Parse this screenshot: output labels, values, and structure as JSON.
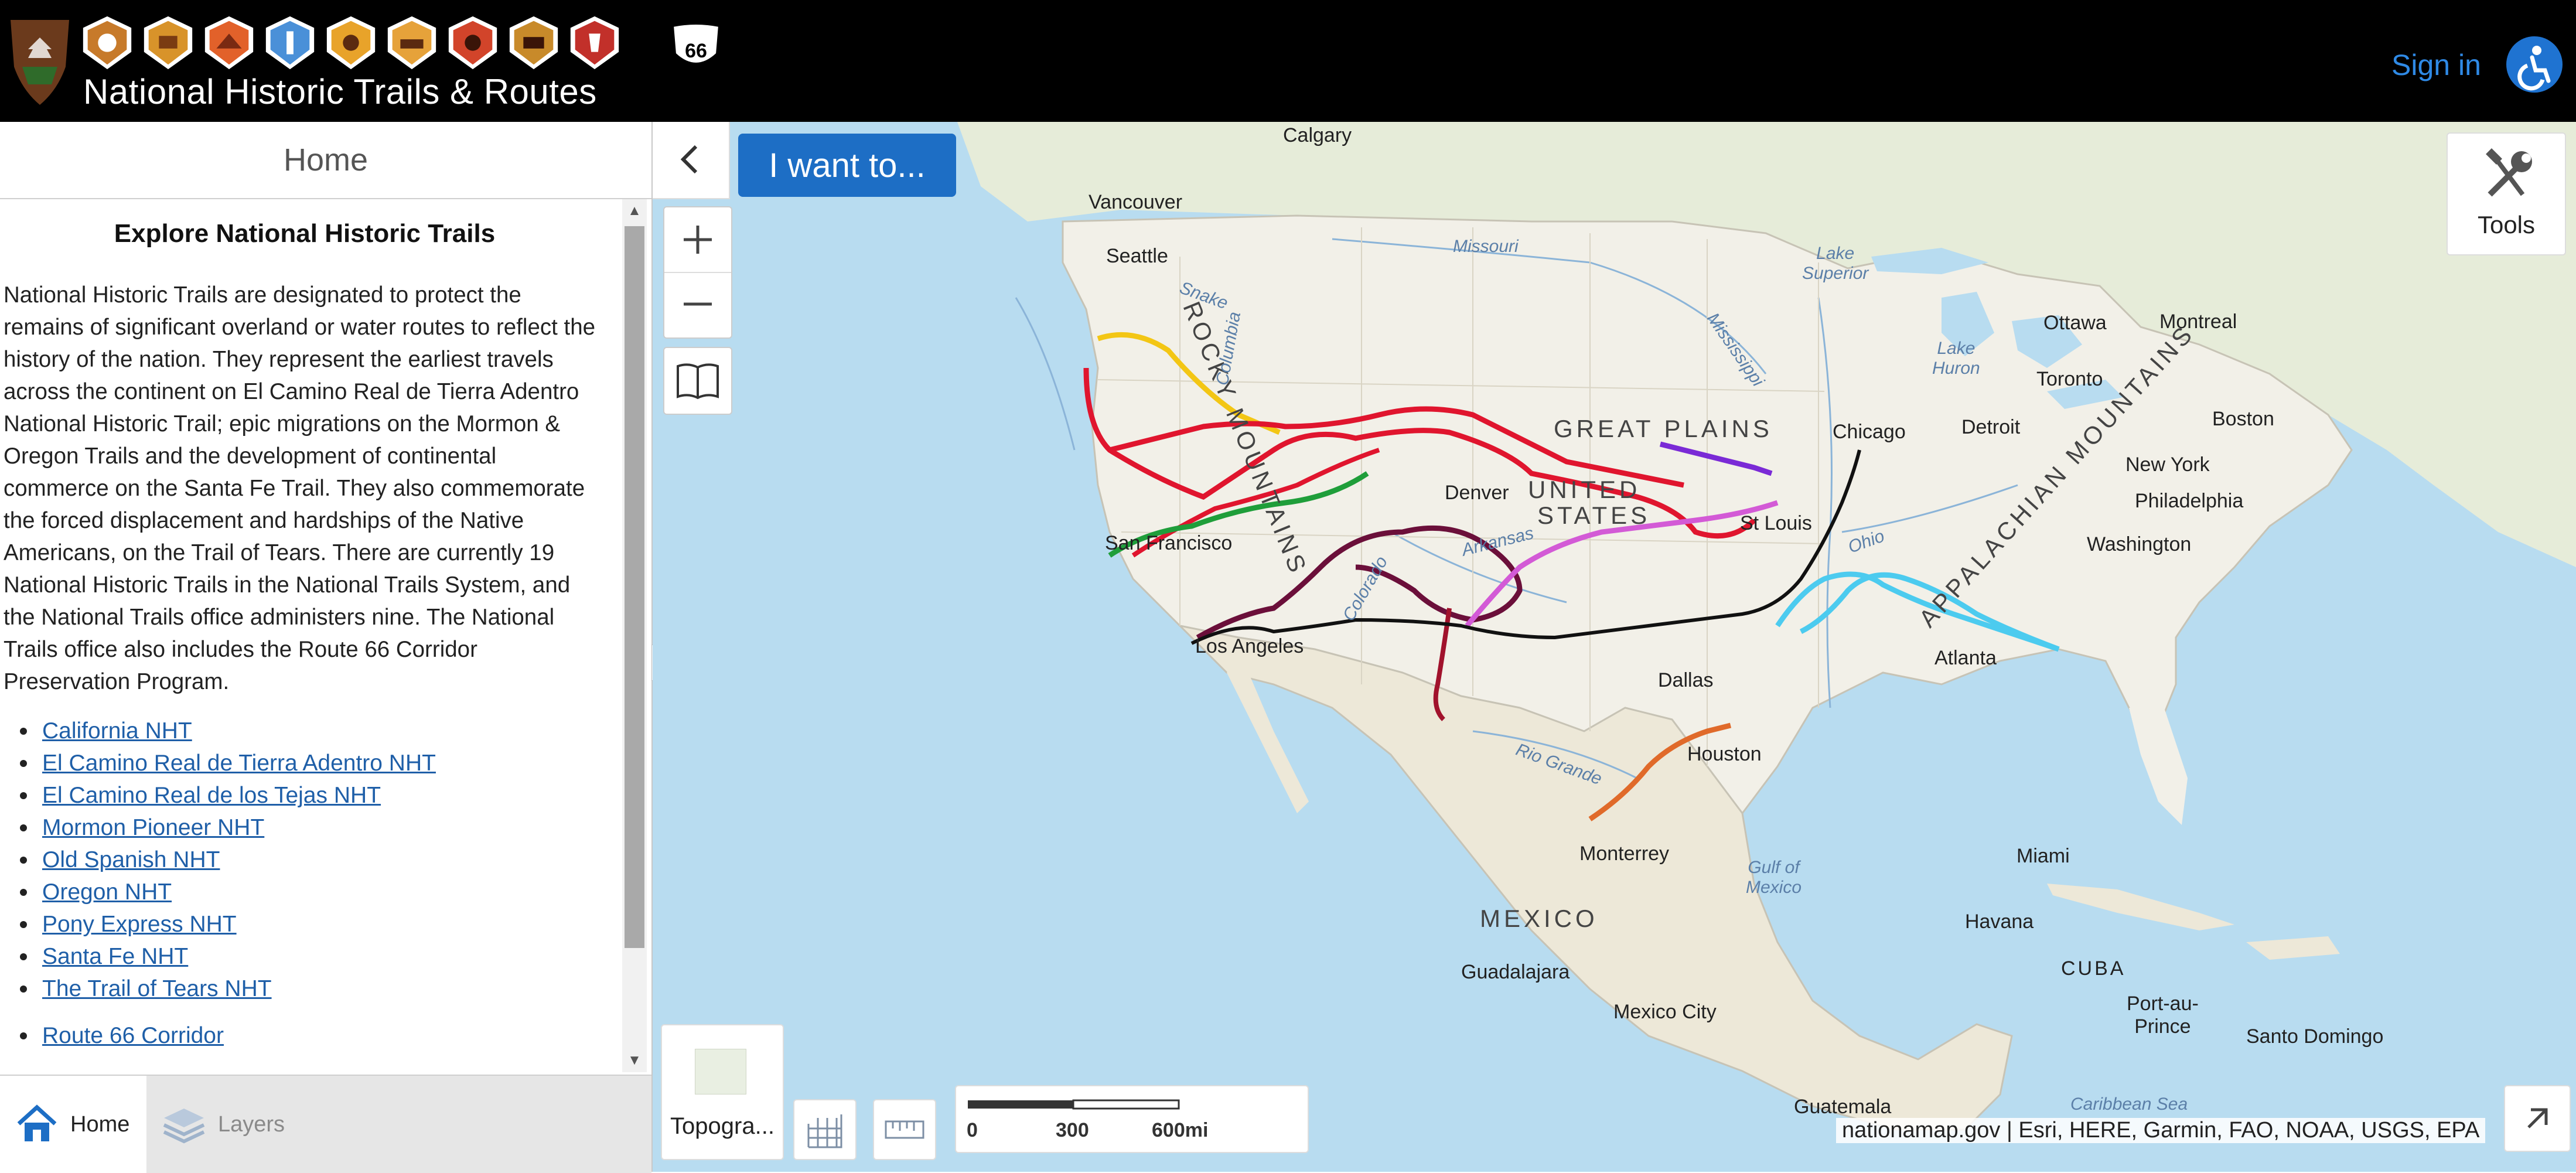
{
  "header": {
    "title": "National Historic Trails & Routes",
    "sign_in": "Sign in",
    "badges": [
      "california-trail-badge",
      "camino-real-tierra-adentro-badge",
      "camino-real-tejas-badge",
      "mormon-pioneer-badge",
      "old-spanish-badge",
      "oregon-trail-badge",
      "pony-express-badge",
      "santa-fe-badge",
      "trail-of-tears-badge"
    ],
    "route_shield": "66"
  },
  "panel": {
    "heading": "Home",
    "explore_title": "Explore National Historic Trails",
    "intro": "National Historic Trails are designated to protect the remains of significant overland or water routes to reflect the history of the nation. They represent the earliest travels across the continent on El Camino Real de Tierra Adentro National Historic Trail; epic migrations on the Mormon & Oregon Trails and the development of continental commerce on the Santa Fe Trail. They also commemorate the forced displacement and hardships of the Native Americans, on the Trail of Tears. There are currently 19 National Historic Trails in the National Trails System, and the National Trails office administers nine. The National Trails office also includes the Route 66 Corridor Preservation Program.",
    "trails": [
      "California NHT",
      "El Camino Real de Tierra Adentro NHT",
      "El Camino Real de los Tejas NHT",
      "Mormon Pioneer NHT",
      "Old Spanish NHT",
      "Oregon NHT",
      "Pony Express NHT",
      "Santa Fe NHT",
      "The Trail of Tears NHT"
    ],
    "route": "Route 66 Corridor"
  },
  "tabs": {
    "home": "Home",
    "layers": "Layers"
  },
  "map": {
    "want_to": "I want to...",
    "tools": "Tools",
    "basemap_label": "Topogra...",
    "scale": {
      "zero": "0",
      "mid": "300",
      "max": "600mi"
    },
    "attribution": "nationamap.gov | Esri, HERE, Garmin, FAO, NOAA, USGS, EPA",
    "labels": {
      "calgary": "Calgary",
      "vancouver": "Vancouver",
      "seattle": "Seattle",
      "san_francisco": "San Francisco",
      "los_angeles": "Los Angeles",
      "denver": "Denver",
      "dallas": "Dallas",
      "houston": "Houston",
      "monterrey": "Monterrey",
      "guadalajara": "Guadalajara",
      "mexico_city": "Mexico City",
      "guatemala": "Guatemala",
      "st_louis": "St Louis",
      "chicago": "Chicago",
      "detroit": "Detroit",
      "toronto": "Toronto",
      "ottawa": "Ottawa",
      "montreal": "Montreal",
      "boston": "Boston",
      "new_york": "New York",
      "philadelphia": "Philadelphia",
      "washington": "Washington",
      "atlanta": "Atlanta",
      "miami": "Miami",
      "havana": "Havana",
      "cuba": "CUBA",
      "port_au_prince": "Port-au-\nPrince",
      "santo_domingo": "Santo Domingo",
      "great_plains": "GREAT PLAINS",
      "united": "UNITED",
      "states": "STATES",
      "mexico": "MEXICO",
      "rocky": "ROCKY MOUNTAINS",
      "appalachian": "APPALACHIAN MOUNTAINS",
      "lake_superior": "Lake\nSuperior",
      "lake_huron": "Lake\nHuron",
      "missouri": "Missouri",
      "mississippi": "Mississippi",
      "arkansas": "Arkansas",
      "ohio": "Ohio",
      "rio_grande": "Rio Grande",
      "gulf": "Gulf of\nMexico",
      "columbia": "Columbia",
      "snake": "Snake",
      "colorado": "Colorado",
      "caribbean": "Caribbean Sea"
    }
  },
  "colors": {
    "header_bg": "#000000",
    "accent": "#1d6ec5",
    "link": "#1f5fa8",
    "california": "#e0152e",
    "oregon": "#e0152e",
    "mormon": "#7a2ad6",
    "pony_express": "#1f9e3a",
    "old_spanish": "#6b0f3a",
    "santa_fe": "#d35ad6",
    "route66": "#111111",
    "trail_of_tears": "#4ccbef",
    "tejas": "#e06a2a",
    "idaho": "#f3c614"
  }
}
